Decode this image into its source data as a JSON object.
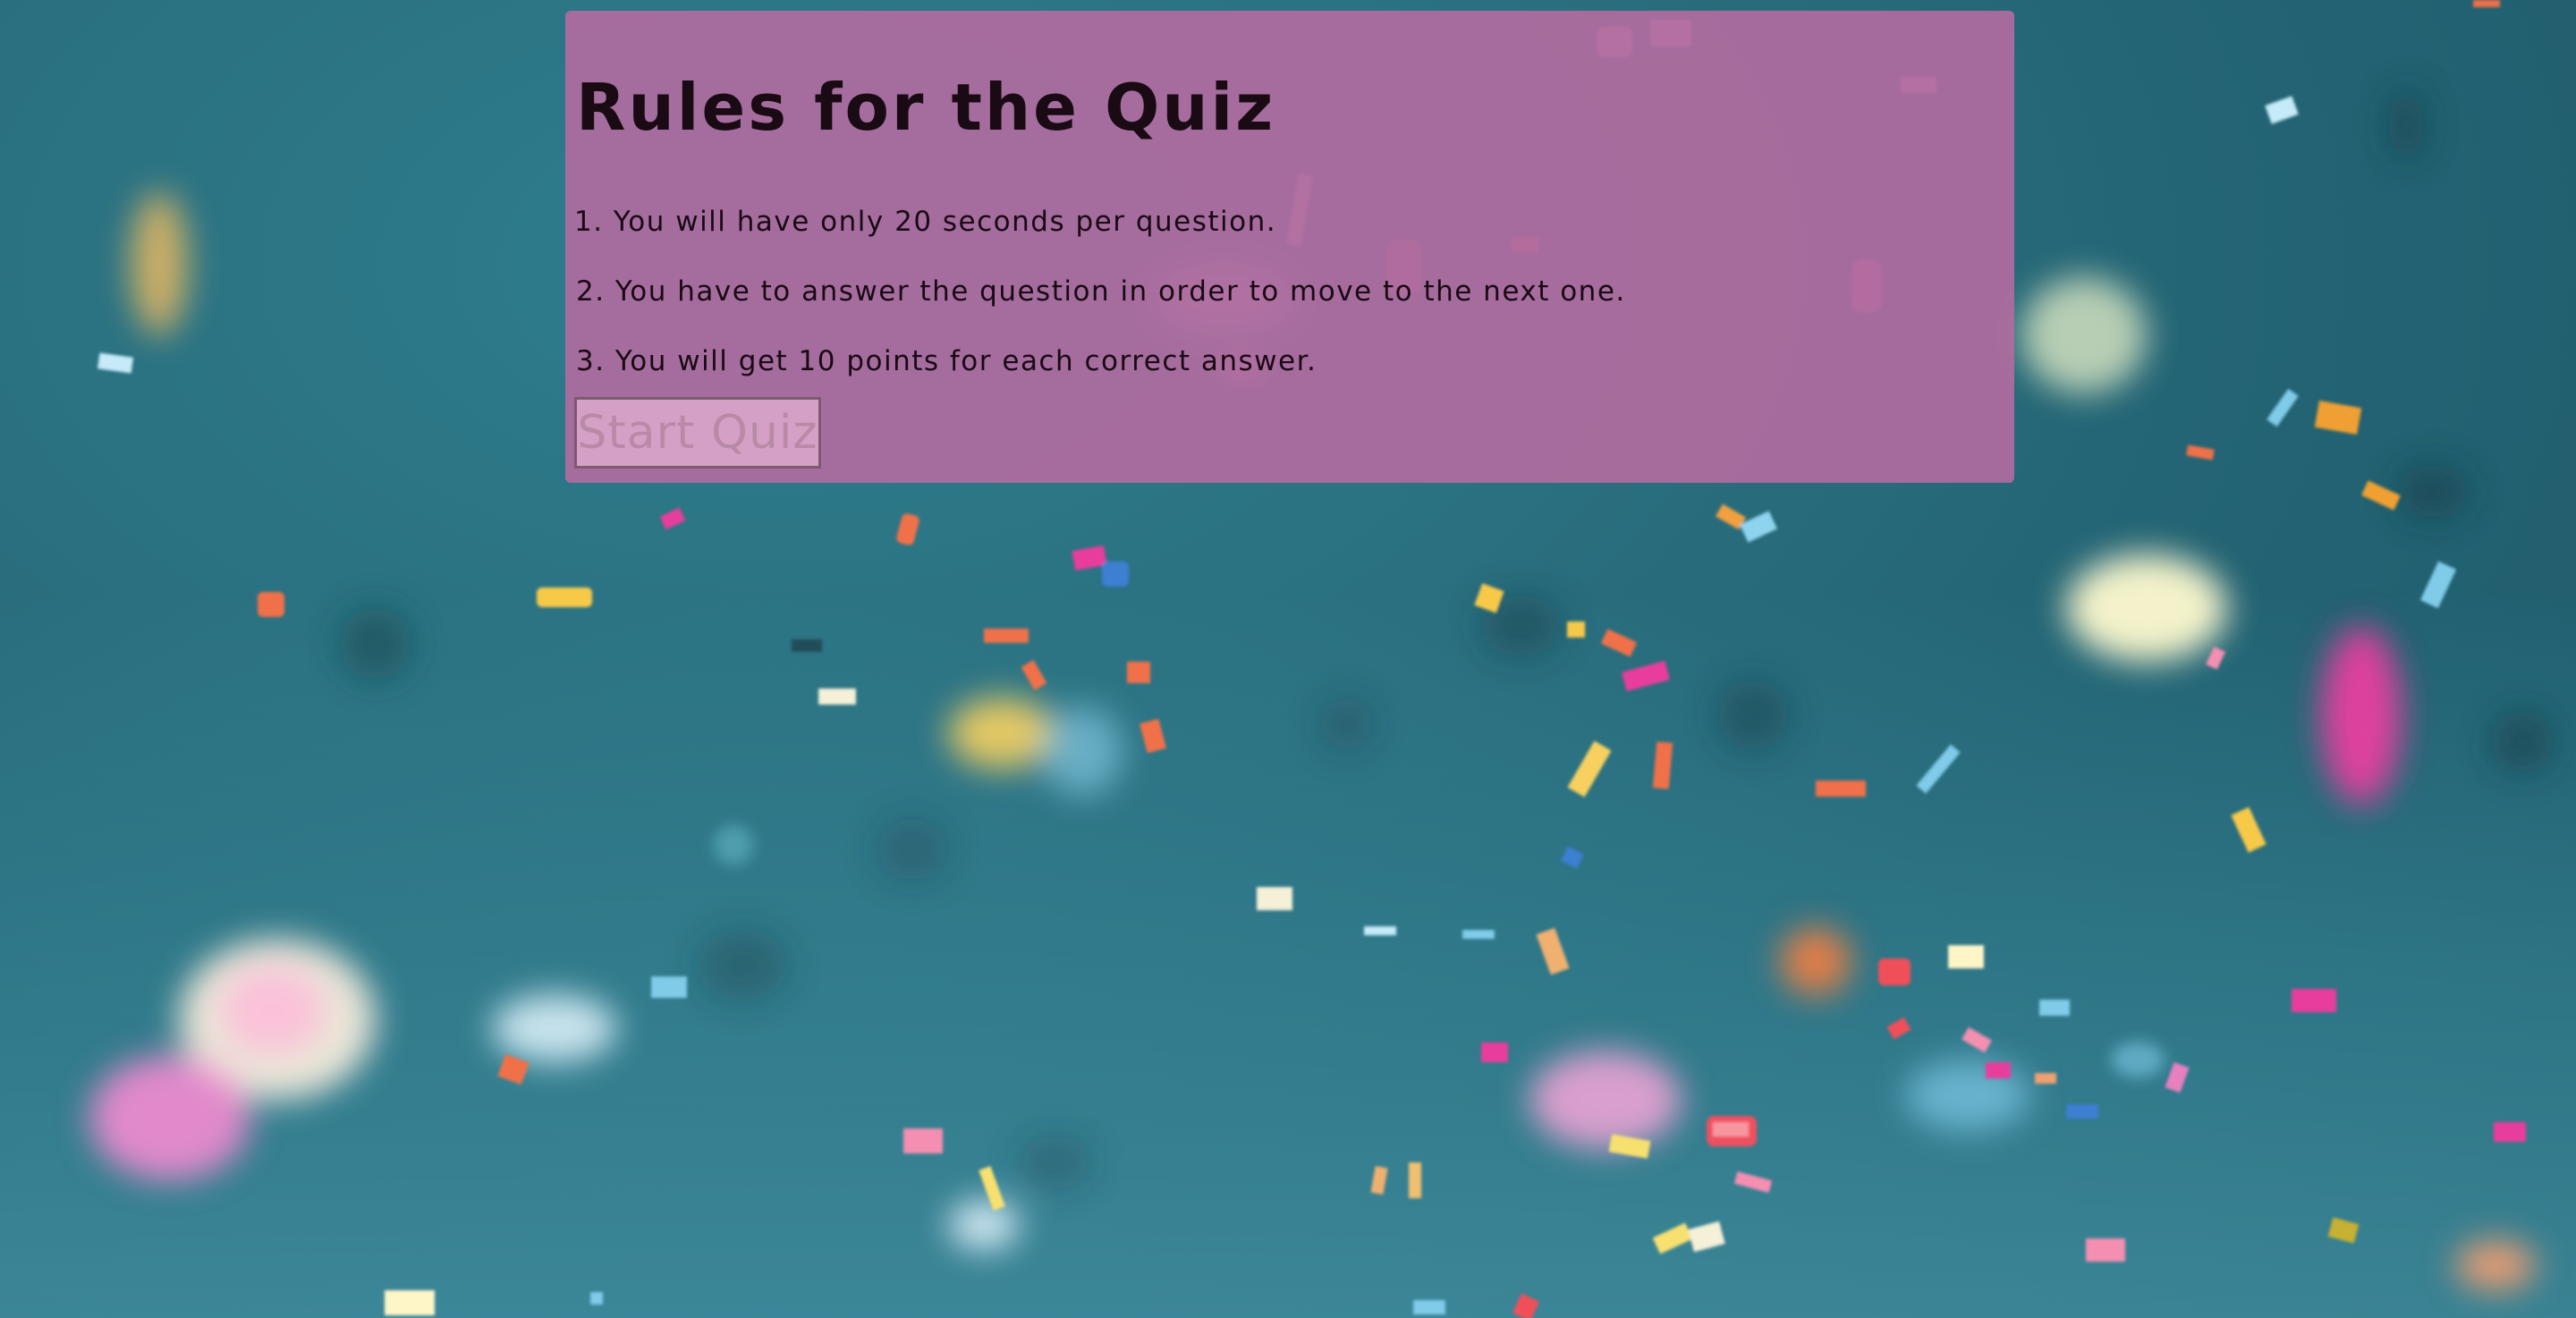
{
  "rules": {
    "title": "Rules for the Quiz",
    "items": [
      "1. You will have only 20 seconds per question.",
      "2. You have to answer the question in order to move to the next one.",
      "3. You will get 10 points for each correct answer."
    ],
    "start_button_label": "Start Quiz"
  },
  "colors": {
    "background": "#236373",
    "panel": "#b26ca0",
    "text": "#1a0a14",
    "button_bg": "#deaacd",
    "button_text": "#b98aa7",
    "confetti": [
      "#f7c948",
      "#f0714a",
      "#e83e9c",
      "#7fd0f0",
      "#fff6c8",
      "#f5f0d8",
      "#f48fb1"
    ]
  },
  "background_image": "confetti-celebration-background"
}
